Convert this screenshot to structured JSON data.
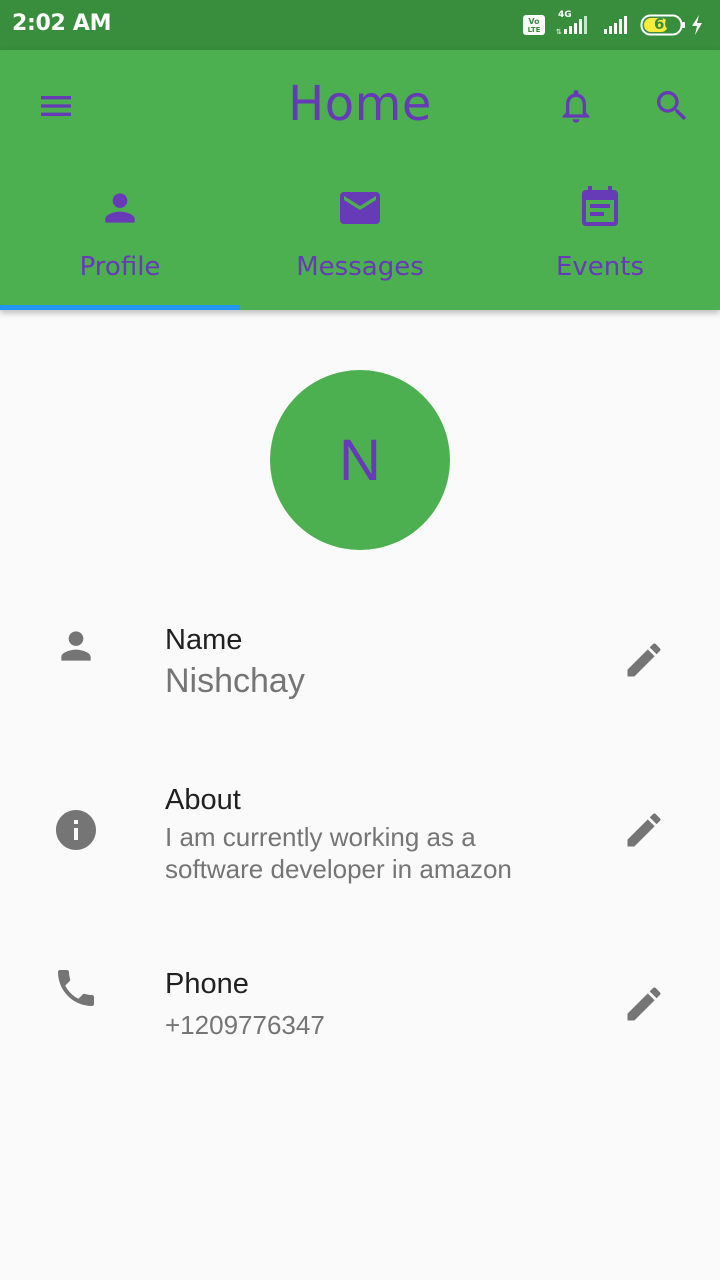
{
  "status_bar": {
    "time": "2:02 AM",
    "volte": "Vo LTE",
    "network": "4G",
    "battery": "60",
    "icons": [
      "volte-icon",
      "signal-icon",
      "signal-icon",
      "battery-icon",
      "charging-icon"
    ]
  },
  "app_bar": {
    "title": "Home",
    "icons": [
      "menu-icon",
      "bell-icon",
      "search-icon"
    ],
    "tabs": [
      {
        "label": "Profile",
        "icon": "person-icon",
        "selected": true
      },
      {
        "label": "Messages",
        "icon": "mail-icon",
        "selected": false
      },
      {
        "label": "Events",
        "icon": "calendar-icon",
        "selected": false
      }
    ]
  },
  "profile": {
    "avatar_initial": "N",
    "fields": [
      {
        "title": "Name",
        "value": "Nishchay",
        "icon": "person-icon",
        "action_icon": "edit-icon"
      },
      {
        "title": "About",
        "value": "I am currently working as a",
        "value_line2": "software developer in amazon",
        "icon": "info-icon",
        "action_icon": "edit-icon"
      },
      {
        "title": "Phone",
        "value": "+1209776347",
        "icon": "phone-icon",
        "action_icon": "edit-icon"
      }
    ]
  },
  "colors": {
    "status_bar": "#388e3c",
    "app_bar": "#4caf50",
    "accent": "#673ab7",
    "tab_indicator": "#2196f3",
    "background": "#fafafa",
    "icon_grey": "#757575"
  }
}
